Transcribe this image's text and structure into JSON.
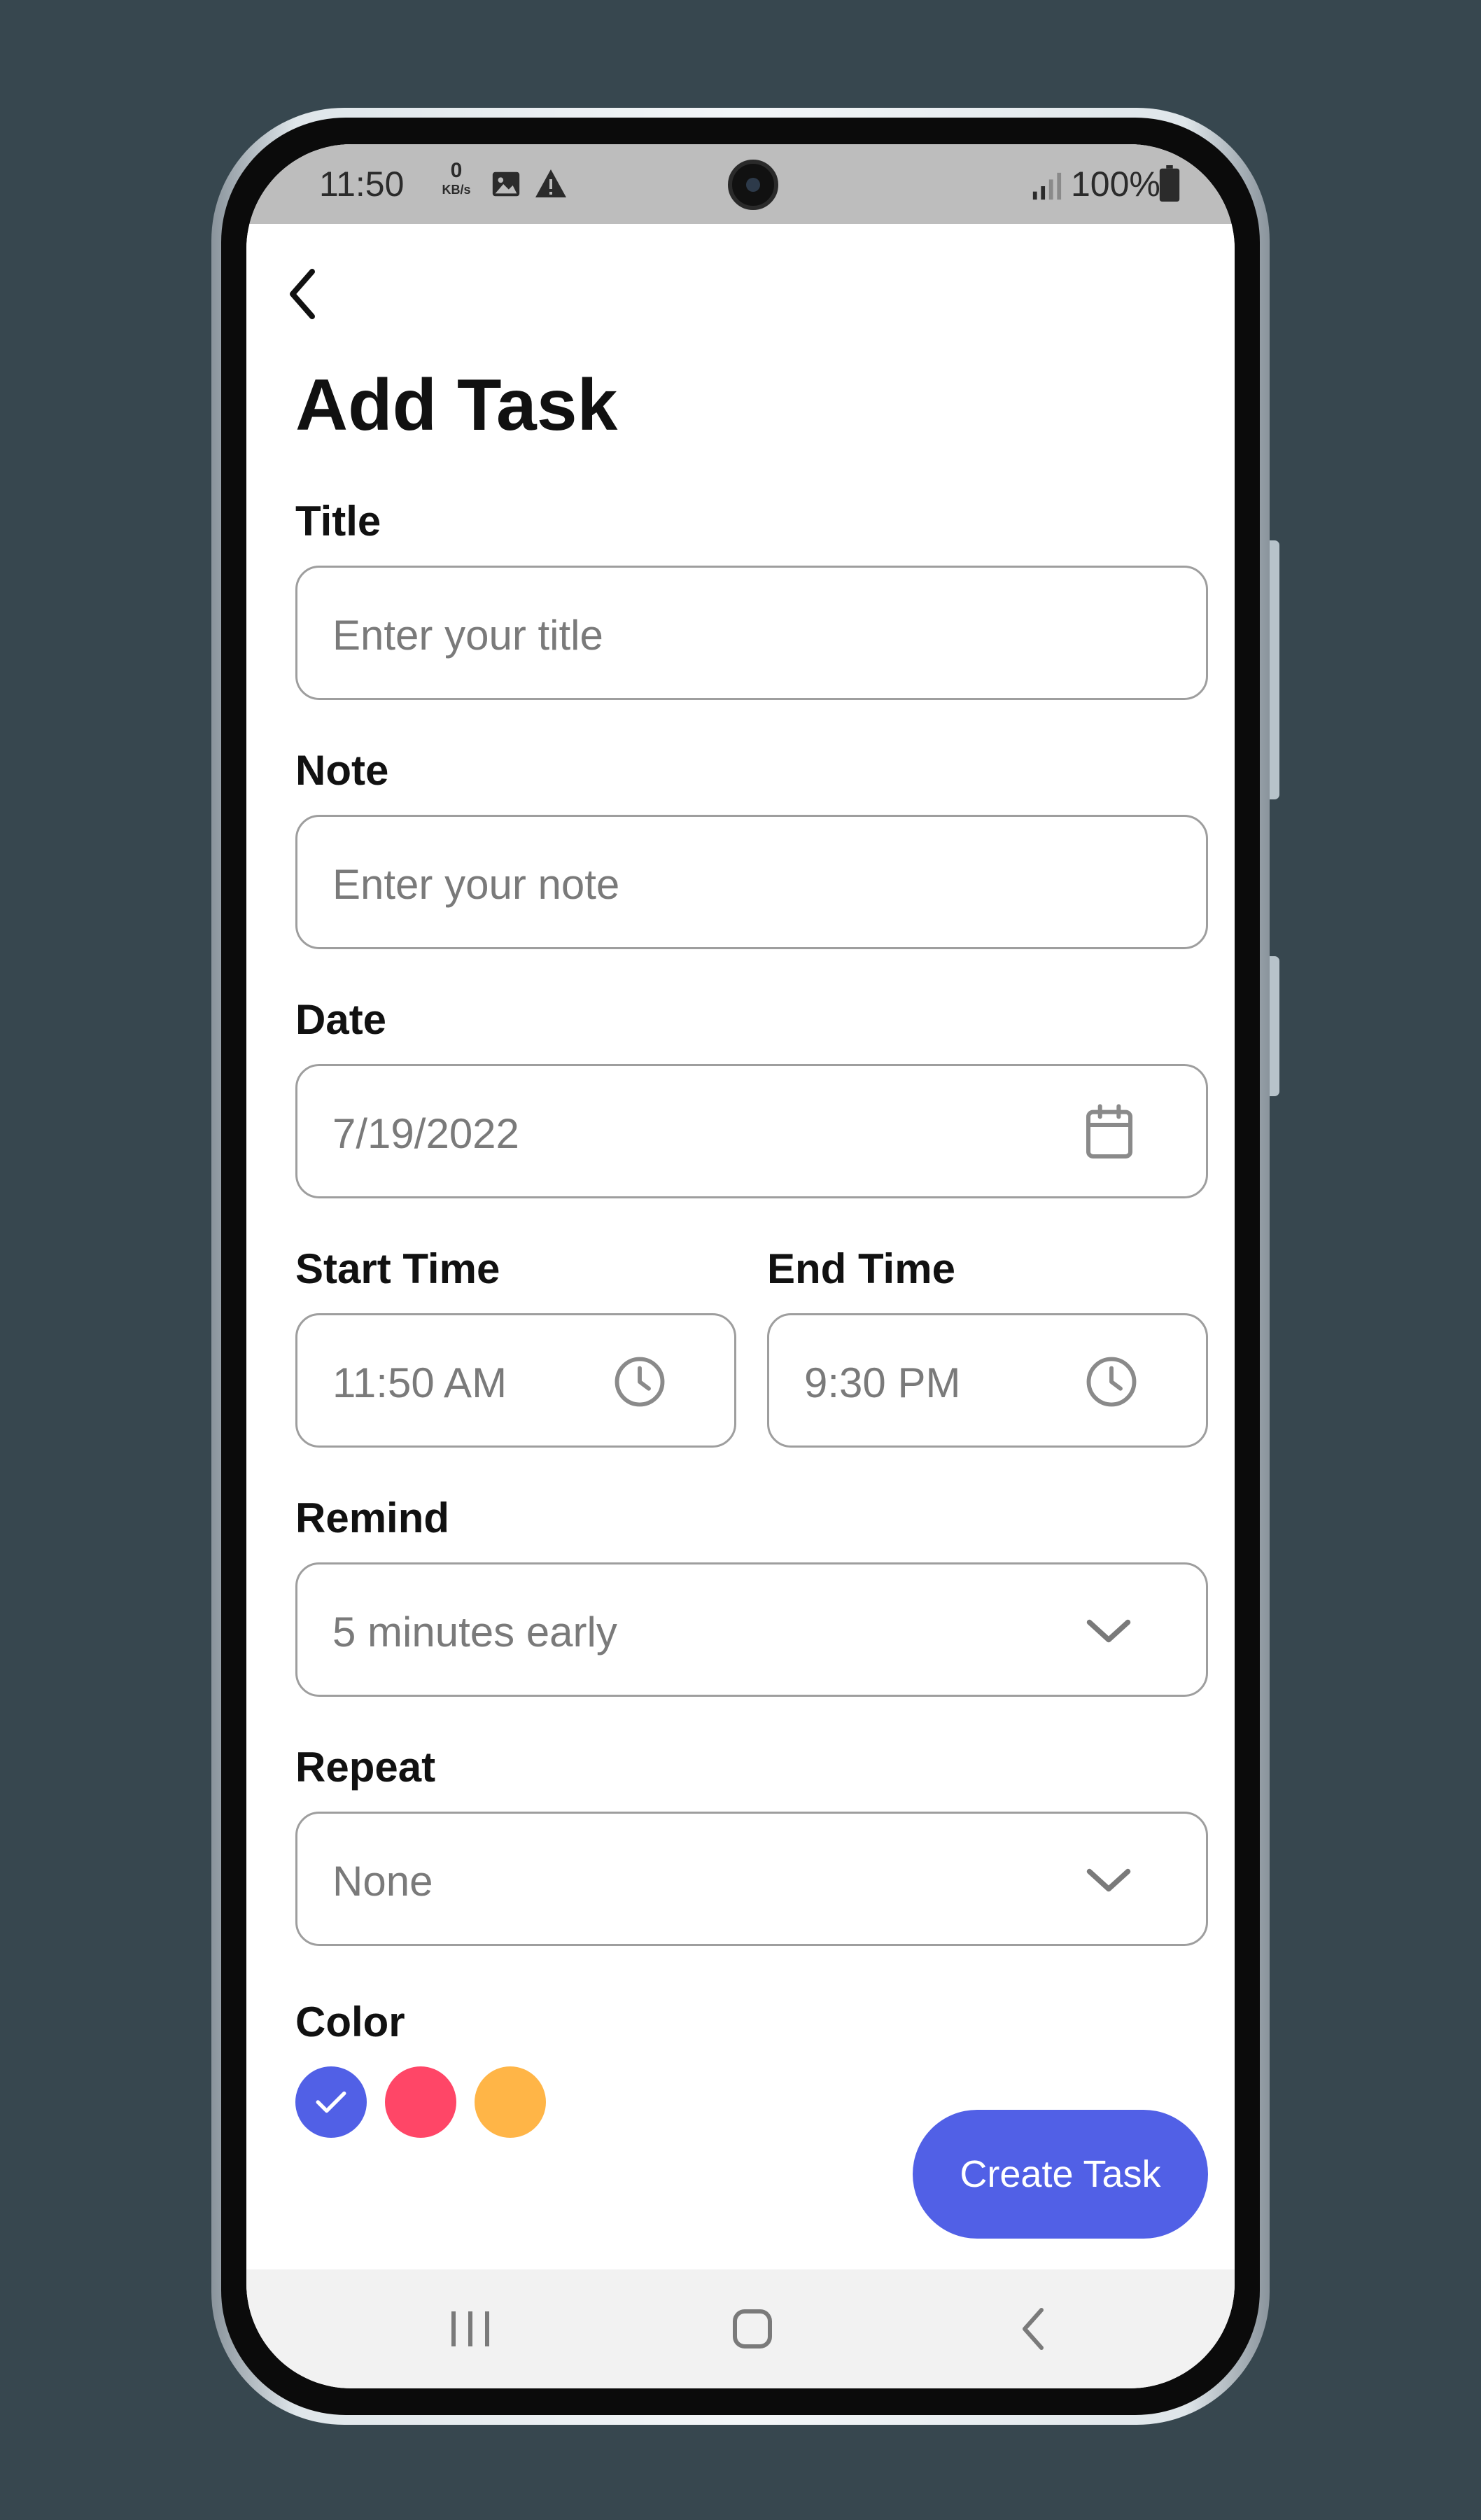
{
  "status_bar": {
    "time": "11:50",
    "net_speed_value": "0",
    "net_speed_unit": "KB/s",
    "battery": "100%"
  },
  "header": {
    "title": "Add Task"
  },
  "form": {
    "title": {
      "label": "Title",
      "placeholder": "Enter your title"
    },
    "note": {
      "label": "Note",
      "placeholder": "Enter your note"
    },
    "date": {
      "label": "Date",
      "value": "7/19/2022",
      "icon": "calendar-icon"
    },
    "start_time": {
      "label": "Start Time",
      "value": "11:50 AM",
      "icon": "clock-icon"
    },
    "end_time": {
      "label": "End Time",
      "value": "9:30 PM",
      "icon": "clock-icon"
    },
    "remind": {
      "label": "Remind",
      "value": "5 minutes early",
      "icon": "chevron-down-icon"
    },
    "repeat": {
      "label": "Repeat",
      "value": "None",
      "icon": "chevron-down-icon"
    }
  },
  "color_picker": {
    "label": "Color",
    "options": [
      {
        "name": "blue",
        "hex": "#5160e6",
        "selected": true
      },
      {
        "name": "pink",
        "hex": "#ff4667",
        "selected": false
      },
      {
        "name": "orange",
        "hex": "#ffb547",
        "selected": false
      }
    ]
  },
  "actions": {
    "create_label": "Create Task",
    "create_color": "#5160e6"
  },
  "theme": {
    "background": "#37474f",
    "text_primary": "#111111",
    "placeholder": "#7a7a7a",
    "border": "#9e9e9e"
  }
}
